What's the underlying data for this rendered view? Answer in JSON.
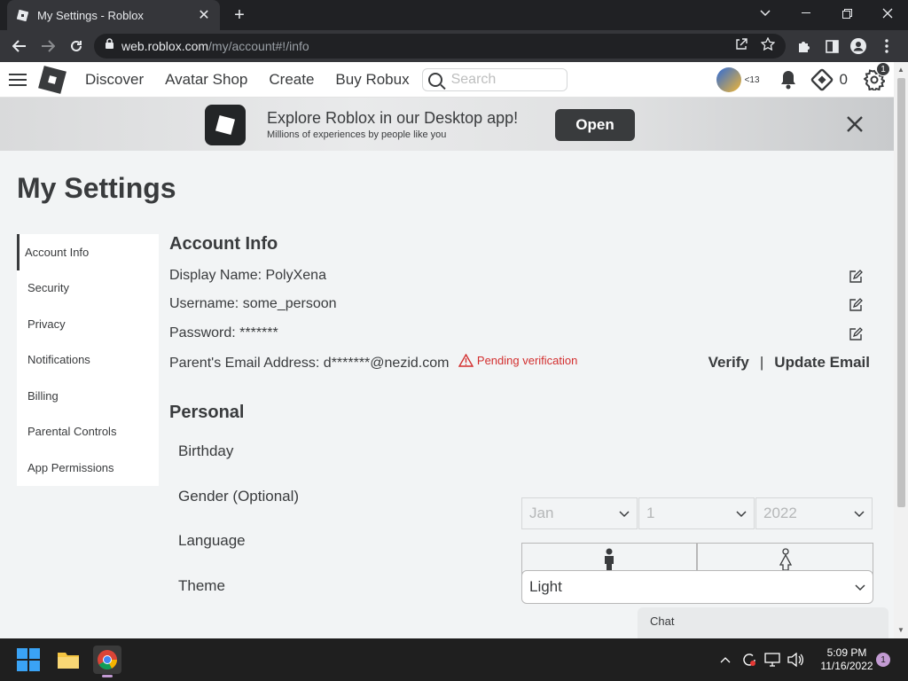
{
  "browser": {
    "tab_title": "My Settings - Roblox",
    "new_tab": "+",
    "url_host": "web.roblox.com",
    "url_path": "/my/account#!/info"
  },
  "nav": {
    "links": [
      "Discover",
      "Avatar Shop",
      "Create",
      "Buy Robux"
    ],
    "search_placeholder": "Search",
    "age_label": "<13",
    "robux_count": "0",
    "settings_badge": "1"
  },
  "banner": {
    "title": "Explore Roblox in our Desktop app!",
    "subtitle": "Millions of experiences by people like you",
    "open_label": "Open"
  },
  "page": {
    "title": "My Settings",
    "menu": [
      "Account Info",
      "Security",
      "Privacy",
      "Notifications",
      "Billing",
      "Parental Controls",
      "App Permissions"
    ]
  },
  "account": {
    "heading": "Account Info",
    "display_name": "Display Name: PolyXena",
    "username": "Username: some_persoon",
    "password": "Password: *******",
    "parent_email": "Parent's Email Address: d*******@nezid.com",
    "pending": "Pending verification",
    "verify": "Verify",
    "separator": "|",
    "update_email": "Update Email"
  },
  "personal": {
    "heading": "Personal",
    "birthday_label": "Birthday",
    "birth_month": "Jan",
    "birth_day": "1",
    "birth_year": "2022",
    "gender_label": "Gender (Optional)",
    "language_label": "Language",
    "theme_label": "Theme",
    "theme_value": "Light"
  },
  "chat": {
    "label": "Chat"
  },
  "taskbar": {
    "time": "5:09 PM",
    "date": "11/16/2022",
    "notification_count": "1"
  },
  "colors": {
    "accent": "#393b3d",
    "warning": "#d32f2f",
    "page_bg": "#f2f4f5"
  }
}
